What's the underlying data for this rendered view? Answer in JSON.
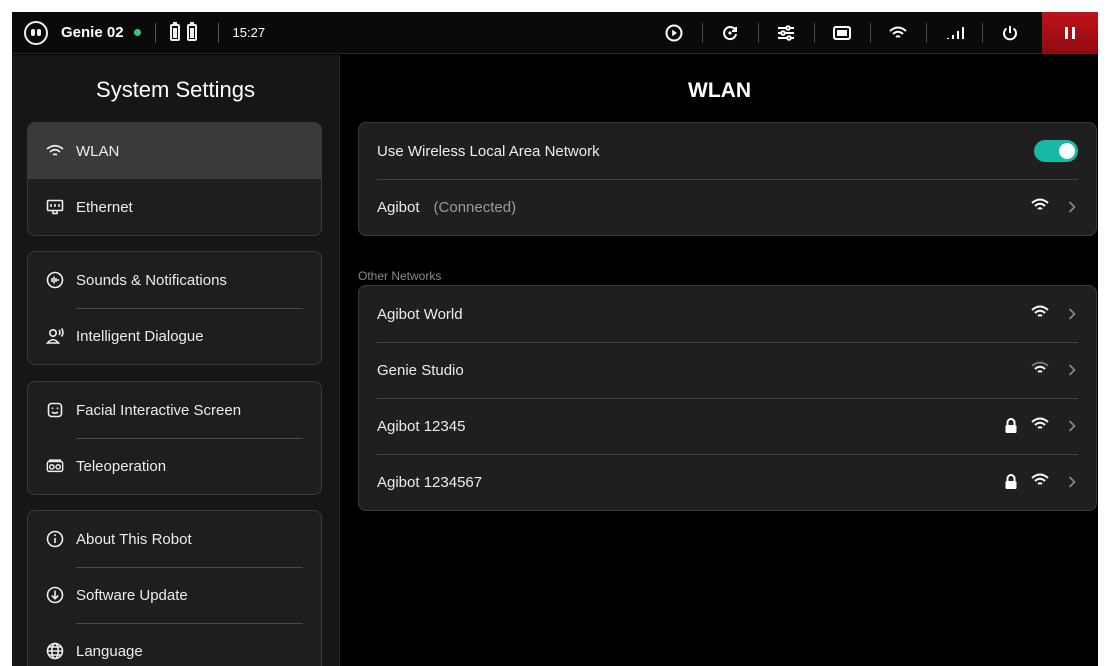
{
  "statusbar": {
    "robot_name": "Genie 02",
    "time": "15:27",
    "icons": [
      "robot-face-icon",
      "battery-icon",
      "battery-icon",
      "play-circle-icon",
      "refresh-icon",
      "sliders-icon",
      "screen-icon",
      "wifi-icon",
      "signal-icon",
      "power-icon",
      "pause-icon"
    ],
    "online_color": "#2ecc71",
    "emergency_color": "#c1121a"
  },
  "sidebar": {
    "title": "System Settings",
    "groups": [
      {
        "items": [
          {
            "label": "WLAN",
            "icon": "wifi-icon",
            "active": true
          },
          {
            "label": "Ethernet",
            "icon": "ethernet-icon"
          }
        ]
      },
      {
        "items": [
          {
            "label": "Sounds & Notifications",
            "icon": "sound-icon"
          },
          {
            "label": "Intelligent Dialogue",
            "icon": "dialogue-icon"
          }
        ]
      },
      {
        "items": [
          {
            "label": "Facial Interactive Screen",
            "icon": "face-screen-icon"
          },
          {
            "label": "Teleoperation",
            "icon": "vr-headset-icon"
          }
        ]
      },
      {
        "items": [
          {
            "label": "About This Robot",
            "icon": "info-icon"
          },
          {
            "label": "Software Update",
            "icon": "download-icon"
          },
          {
            "label": "Language",
            "icon": "globe-icon"
          }
        ]
      }
    ]
  },
  "main": {
    "title": "WLAN",
    "wlan_toggle_label": "Use Wireless Local Area Network",
    "wlan_enabled": true,
    "toggle_color": "#17b8a6",
    "connected": {
      "name": "Agibot",
      "status": "(Connected)"
    },
    "other_label": "Other Networks",
    "networks": [
      {
        "name": "Agibot World",
        "locked": false
      },
      {
        "name": "Genie Studio",
        "locked": false
      },
      {
        "name": "Agibot 12345",
        "locked": true
      },
      {
        "name": "Agibot 1234567",
        "locked": true
      }
    ]
  }
}
